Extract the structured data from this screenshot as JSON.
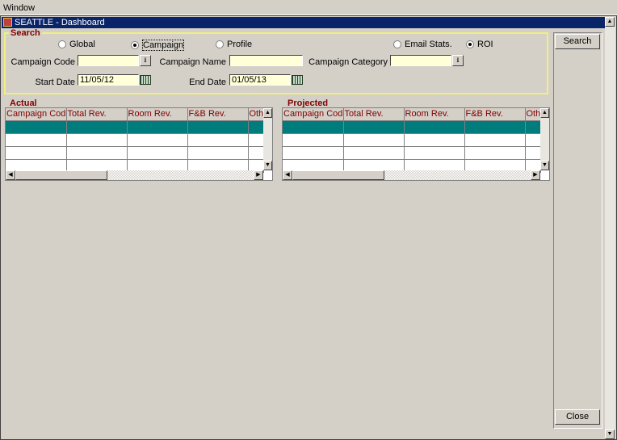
{
  "menu": {
    "window": "Window"
  },
  "window": {
    "title": "SEATTLE - Dashboard"
  },
  "search": {
    "legend": "Search",
    "radios": [
      {
        "label": "Global",
        "checked": false
      },
      {
        "label": "Campaign",
        "checked": true
      },
      {
        "label": "Profile",
        "checked": false
      },
      {
        "label": "Email Stats.",
        "checked": false
      },
      {
        "label": "ROI",
        "checked": true
      }
    ],
    "campaign_code_label": "Campaign Code",
    "campaign_code": "",
    "campaign_name_label": "Campaign Name",
    "campaign_name": "",
    "campaign_category_label": "Campaign Category",
    "campaign_category": "",
    "start_date_label": "Start Date",
    "start_date": "11/05/12",
    "end_date_label": "End Date",
    "end_date": "01/05/13"
  },
  "buttons": {
    "search": "Search",
    "close": "Close"
  },
  "actual": {
    "title": "Actual",
    "columns": [
      "Campaign Code",
      "Total Rev.",
      "Room Rev.",
      "F&B Rev.",
      "Oth."
    ]
  },
  "projected": {
    "title": "Projected",
    "columns": [
      "Campaign Code",
      "Total Rev.",
      "Room Rev.",
      "F&B Rev.",
      "Oth."
    ]
  },
  "colors": {
    "titlebar": "#0a246a",
    "selected_row": "#007c7c",
    "section_label": "#800000",
    "input_bg": "#ffffd8"
  }
}
